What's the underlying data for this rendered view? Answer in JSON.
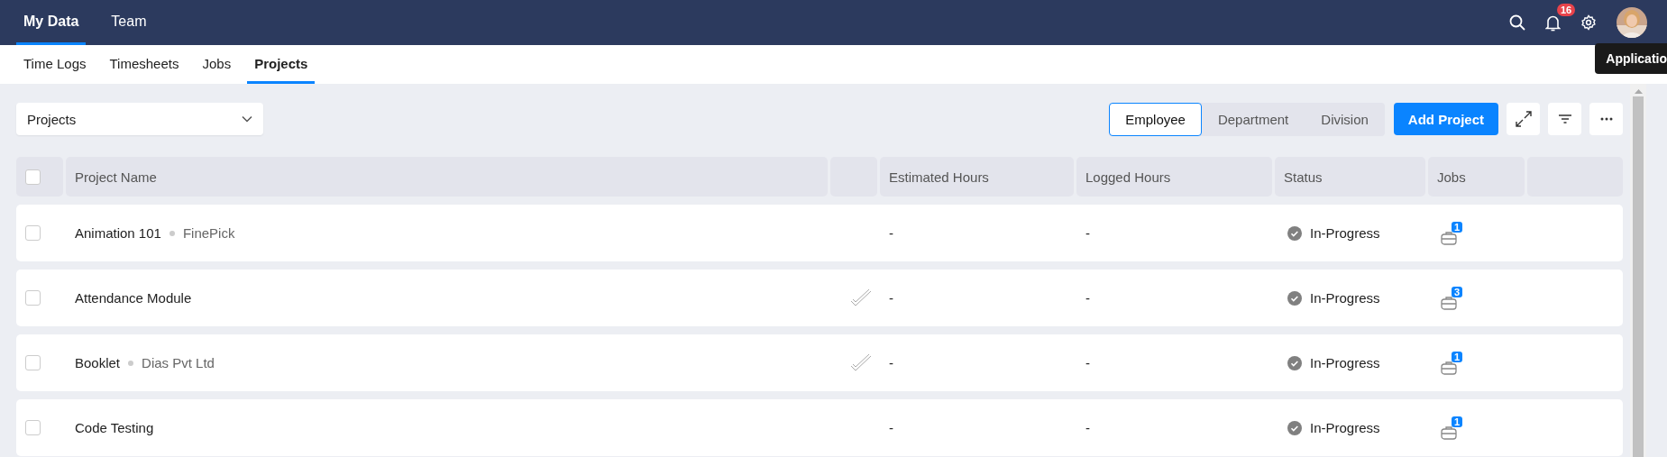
{
  "top_nav": {
    "tabs": [
      {
        "label": "My Data",
        "selected": true
      },
      {
        "label": "Team",
        "selected": false
      }
    ],
    "notifications": {
      "count": "16"
    },
    "tooltip": "Applicatio"
  },
  "sub_nav": {
    "tabs": [
      {
        "label": "Time Logs",
        "selected": false
      },
      {
        "label": "Timesheets",
        "selected": false
      },
      {
        "label": "Jobs",
        "selected": false
      },
      {
        "label": "Projects",
        "selected": true
      }
    ]
  },
  "toolbar": {
    "view_select": {
      "value": "Projects"
    },
    "group_by": [
      {
        "label": "Employee",
        "selected": true
      },
      {
        "label": "Department",
        "selected": false
      },
      {
        "label": "Division",
        "selected": false
      }
    ],
    "add_button": "Add Project"
  },
  "table": {
    "select_all_checked": false,
    "columns": [
      "Project Name",
      "Estimated Hours",
      "Logged Hours",
      "Status",
      "Jobs"
    ],
    "rows": [
      {
        "checked": false,
        "name": "Animation 101",
        "client": "FinePick",
        "approved": false,
        "estimated_hours": "-",
        "logged_hours": "-",
        "status": "In-Progress",
        "jobs": "1"
      },
      {
        "checked": false,
        "name": "Attendance Module",
        "approved": true,
        "estimated_hours": "-",
        "logged_hours": "-",
        "status": "In-Progress",
        "jobs": "3"
      },
      {
        "checked": false,
        "name": "Booklet",
        "client": "Dias Pvt Ltd",
        "approved": true,
        "estimated_hours": "-",
        "logged_hours": "-",
        "status": "In-Progress",
        "jobs": "1"
      },
      {
        "checked": false,
        "name": "Code Testing",
        "approved": false,
        "estimated_hours": "-",
        "logged_hours": "-",
        "status": "In-Progress",
        "jobs": "1"
      }
    ]
  }
}
